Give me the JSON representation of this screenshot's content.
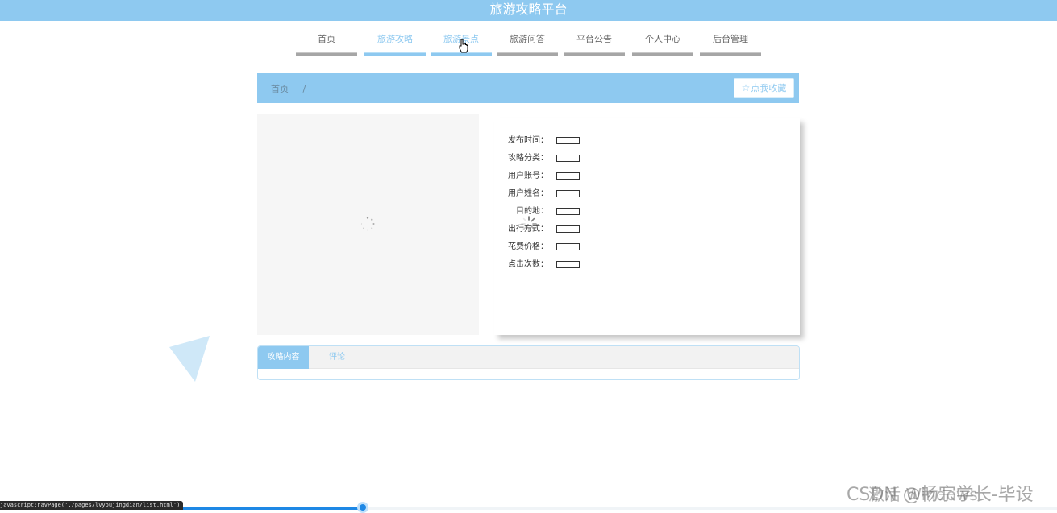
{
  "header": {
    "title": "旅游攻略平台"
  },
  "nav": {
    "items": [
      {
        "label": "首页",
        "active": false
      },
      {
        "label": "旅游攻略",
        "active": true
      },
      {
        "label": "旅游景点",
        "active": true
      },
      {
        "label": "旅游问答",
        "active": false
      },
      {
        "label": "平台公告",
        "active": false
      },
      {
        "label": "个人中心",
        "active": false
      },
      {
        "label": "后台管理",
        "active": false
      }
    ]
  },
  "breadcrumb": {
    "home": "首页",
    "separator": "/"
  },
  "favorite": {
    "icon": "star-icon",
    "label": "点我收藏"
  },
  "details": {
    "fields": [
      {
        "label": "发布时间：",
        "value": ""
      },
      {
        "label": "攻略分类：",
        "value": ""
      },
      {
        "label": "用户账号：",
        "value": ""
      },
      {
        "label": "用户姓名：",
        "value": ""
      },
      {
        "label": "目的地：",
        "value": ""
      },
      {
        "label": "出行方式：",
        "value": ""
      },
      {
        "label": "花费价格：",
        "value": ""
      },
      {
        "label": "点击次数：",
        "value": ""
      }
    ]
  },
  "tabs": [
    {
      "label": "攻略内容",
      "active": true
    },
    {
      "label": "评论",
      "active": false
    }
  ],
  "status": {
    "url": "javascript:navPage('./pages/lvyoujingdian/list.html')",
    "progress": 0.34
  },
  "watermarks": {
    "activate": "激活 Windows",
    "csdn": "CSDN @畅宗学长-毕设"
  },
  "colors": {
    "accent": "#8ec9f0",
    "nav_bar_inactive": "#a6a6a6",
    "progress": "#1e88e5"
  }
}
